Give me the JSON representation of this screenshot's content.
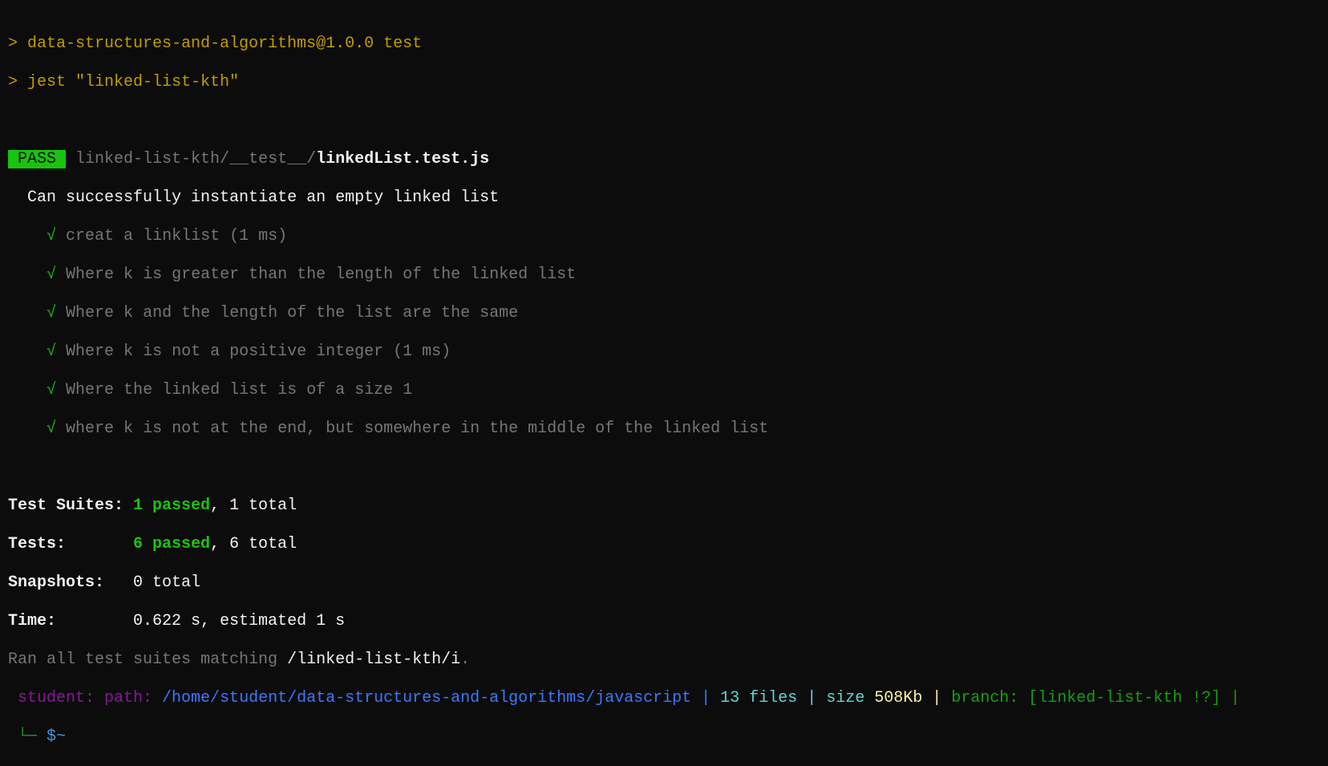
{
  "commands": [
    "> data-structures-and-algorithms@1.0.0 test",
    "> jest \"linked-list-kth\""
  ],
  "result": {
    "badge": " PASS ",
    "path_dir": "linked-list-kth/__test__/",
    "path_file": "linkedList.test.js"
  },
  "describe": "Can successfully instantiate an empty linked list",
  "check": "√",
  "tests": [
    "creat a linklist (1 ms)",
    "Where k is greater than the length of the linked list",
    "Where k and the length of the list are the same",
    "Where k is not a positive integer (1 ms)",
    "Where the linked list is of a size 1",
    "where k is not at the end, but somewhere in the middle of the linked list"
  ],
  "summary": {
    "suites_label": "Test Suites: ",
    "suites_passed": "1 passed",
    "suites_total": ", 1 total",
    "tests_label": "Tests:       ",
    "tests_passed": "6 passed",
    "tests_total": ", 6 total",
    "snapshots_label": "Snapshots:   ",
    "snapshots_value": "0 total",
    "time_label": "Time:        ",
    "time_value": "0.622 s, estimated 1 s",
    "ran_prefix": "Ran all test suites matching ",
    "ran_pattern": "/linked-list-kth/i",
    "ran_suffix": "."
  },
  "prompt": {
    "user": "student:",
    "path_label": " path: ",
    "path": "/home/student/data-structures-and-algorithms/javascript",
    "sep": " | ",
    "files": "13 files",
    "size_label": "size ",
    "size": "508Kb",
    "branch_label": "branch: ",
    "branch": "[linked-list-kth !?]",
    "tail": " |",
    "corner": "└─ ",
    "symbol": "$~"
  }
}
